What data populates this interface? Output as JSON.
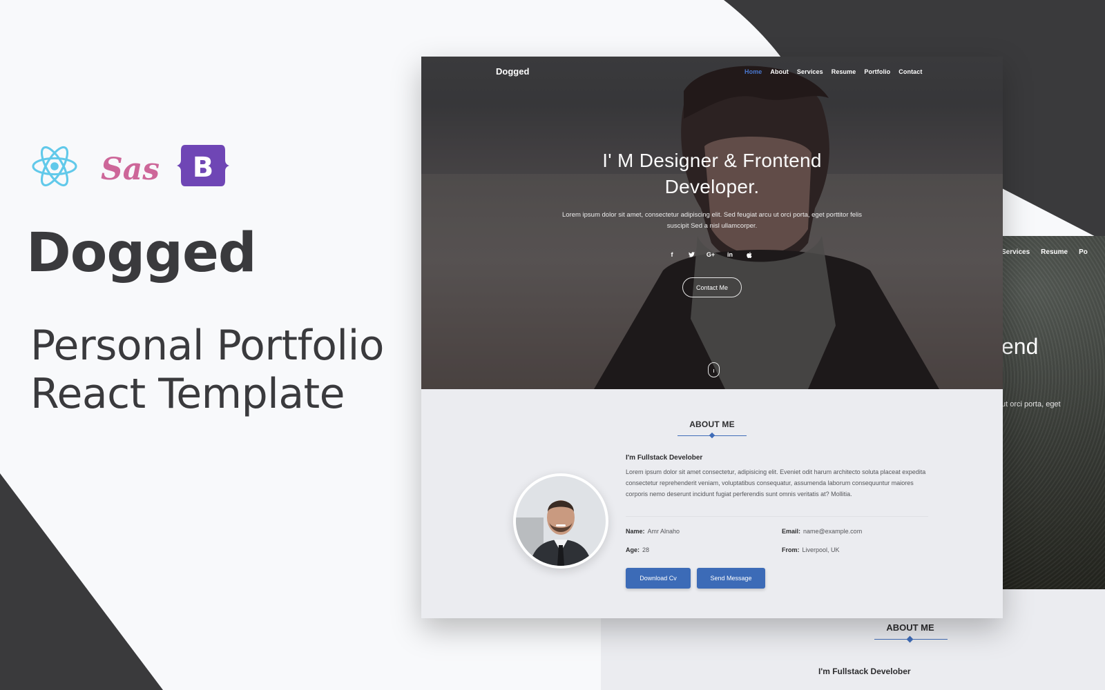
{
  "promo": {
    "tech_logos": [
      {
        "name": "react",
        "color": "#61c9ea"
      },
      {
        "name": "sass",
        "color": "#cd6799"
      },
      {
        "name": "bootstrap",
        "color": "#6f46b5",
        "glyph": "B"
      }
    ],
    "title": "Dogged",
    "subtitle_line1": "Personal Portfolio",
    "subtitle_line2": "React Template"
  },
  "mockup": {
    "brand": "Dogged",
    "nav": [
      {
        "label": "Home",
        "active": true
      },
      {
        "label": "About",
        "active": false
      },
      {
        "label": "Services",
        "active": false
      },
      {
        "label": "Resume",
        "active": false
      },
      {
        "label": "Portfolio",
        "active": false
      },
      {
        "label": "Contact",
        "active": false
      }
    ],
    "hero": {
      "title_line1": "I' M Designer & Frontend",
      "title_line2": "Developer.",
      "text": "Lorem ipsum dolor sit amet, consectetur adipiscing elit. Sed feugiat arcu ut orci porta, eget porttitor felis suscipit Sed a nisl ullamcorper.",
      "socials": [
        "f",
        "t",
        "G+",
        "in",
        ""
      ],
      "social_names": [
        "facebook",
        "twitter",
        "google-plus",
        "linkedin",
        "apple"
      ],
      "cta": "Contact Me"
    },
    "about": {
      "heading": "ABOUT ME",
      "subtitle": "I'm Fullstack Develober",
      "text": "Lorem ipsum dolor sit amet consectetur, adipisicing elit. Eveniet odit harum architecto soluta placeat expedita consectetur reprehenderit veniam, voluptatibus consequatur, assumenda laborum consequuntur maiores corporis nemo deserunt incidunt fugiat perferendis sunt omnis veritatis at? Mollitia.",
      "info": {
        "name_label": "Name:",
        "name": "Amr Alnaho",
        "email_label": "Email:",
        "email": "name@example.com",
        "age_label": "Age:",
        "age": "28",
        "from_label": "From:",
        "from": "Liverpool, UK"
      },
      "buttons": {
        "download": "Download Cv",
        "message": "Send Message"
      }
    },
    "accent": "#3c6bb7"
  },
  "back_mockup": {
    "nav": [
      "Services",
      "Resume",
      "Po"
    ],
    "hero_title_fragment": "end",
    "hero_text_fragment": "ut orci porta, eget",
    "about_heading": "ABOUT ME",
    "about_subtitle": "I'm Fullstack Develober"
  }
}
